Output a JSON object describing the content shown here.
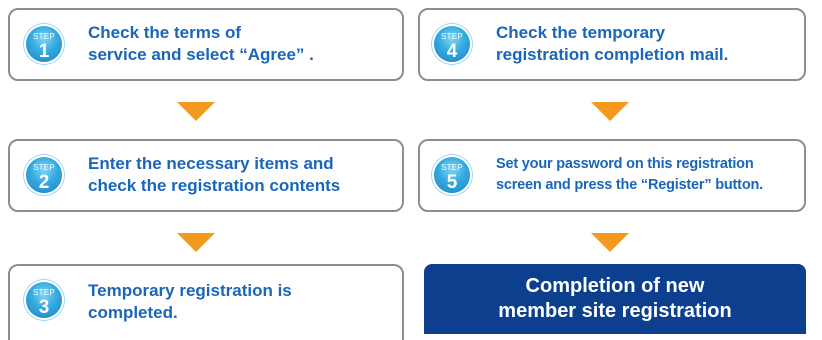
{
  "badge_label": "STEP",
  "colors": {
    "accent_text": "#1a66b8",
    "badge": "#35a9df",
    "arrow": "#f39a1e",
    "final_bg": "#0d3f8f"
  },
  "steps": [
    {
      "num": "1",
      "text": "Check the terms of\nservice and select “Agree” ."
    },
    {
      "num": "2",
      "text": "Enter the necessary items and\ncheck the registration contents"
    },
    {
      "num": "3",
      "text": "Temporary registration is\ncompleted."
    },
    {
      "num": "4",
      "text": "Check the temporary\nregistration completion mail."
    },
    {
      "num": "5",
      "text": "Set your password on this registration\nscreen and press the “Register” button."
    }
  ],
  "final": {
    "text": "Completion of new\nmember site registration"
  }
}
